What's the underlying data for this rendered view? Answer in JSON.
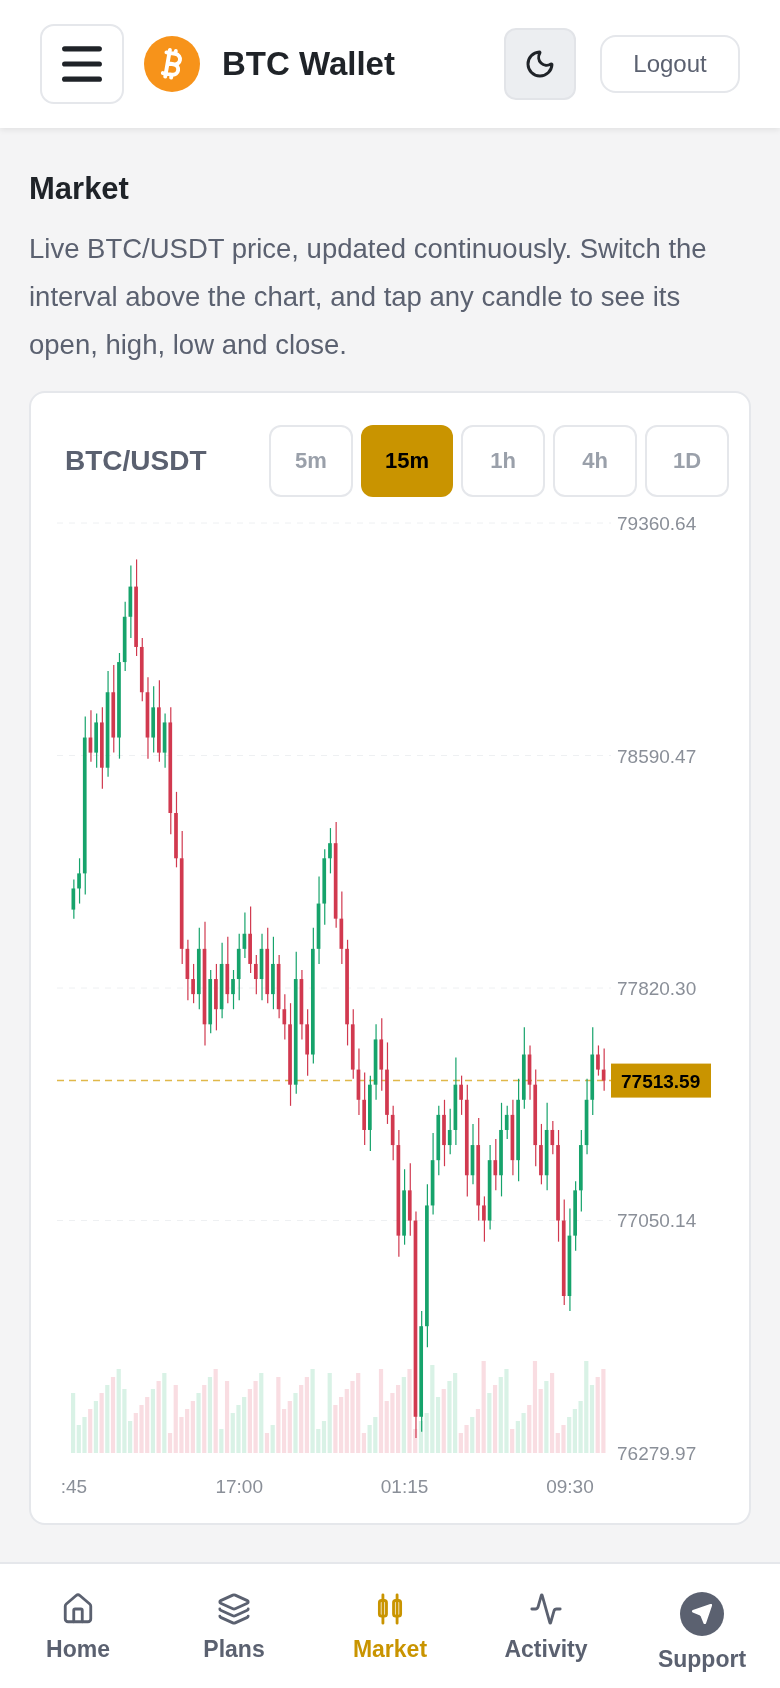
{
  "header": {
    "title": "BTC Wallet",
    "logout": "Logout"
  },
  "page": {
    "title": "Market",
    "description": "Live BTC/USDT price, updated continuously. Switch the interval above the chart, and tap any candle to see its open, high, low and close."
  },
  "chart_card": {
    "pair": "BTC/USDT",
    "intervals": [
      {
        "label": "5m",
        "selected": false
      },
      {
        "label": "15m",
        "selected": true
      },
      {
        "label": "1h",
        "selected": false
      },
      {
        "label": "4h",
        "selected": false
      },
      {
        "label": "1D",
        "selected": false
      }
    ],
    "chart_data": {
      "type": "candlestick",
      "grid": true,
      "ref_lines": [
        {
          "axis": "y",
          "value": 77513.59,
          "label": "77513.59"
        }
      ],
      "ylim": [
        76279.97,
        79360.64
      ],
      "yticks": [
        {
          "value": 79360.64,
          "label": "79360.64"
        },
        {
          "value": 78590.47,
          "label": "78590.47"
        },
        {
          "value": 77820.3,
          "label": "77820.30"
        },
        {
          "value": 77050.14,
          "label": "77050.14"
        },
        {
          "value": 76279.97,
          "label": "76279.97"
        }
      ],
      "categories": [
        ":45",
        null,
        null,
        null,
        null,
        null,
        null,
        null,
        null,
        null,
        null,
        null,
        null,
        null,
        null,
        null,
        null,
        null,
        null,
        null,
        null,
        null,
        null,
        null,
        null,
        null,
        null,
        null,
        null,
        "17:00",
        null,
        null,
        null,
        null,
        null,
        null,
        null,
        null,
        null,
        null,
        null,
        null,
        null,
        null,
        null,
        null,
        null,
        null,
        null,
        null,
        null,
        null,
        null,
        null,
        null,
        null,
        null,
        null,
        "01:15",
        null,
        null,
        null,
        null,
        null,
        null,
        null,
        null,
        null,
        null,
        null,
        null,
        null,
        null,
        null,
        null,
        null,
        null,
        null,
        null,
        null,
        null,
        null,
        null,
        null,
        null,
        null,
        null,
        "09:30",
        null,
        null,
        null,
        null,
        null,
        null
      ],
      "ohlc": [
        [
          78080,
          78180,
          78050,
          78150
        ],
        [
          78150,
          78250,
          78100,
          78200
        ],
        [
          78200,
          78720,
          78130,
          78650
        ],
        [
          78650,
          78740,
          78570,
          78600
        ],
        [
          78600,
          78730,
          78550,
          78700
        ],
        [
          78700,
          78750,
          78480,
          78550
        ],
        [
          78550,
          78870,
          78520,
          78800
        ],
        [
          78800,
          78890,
          78600,
          78650
        ],
        [
          78650,
          78930,
          78580,
          78900
        ],
        [
          78900,
          79100,
          78870,
          79050
        ],
        [
          79050,
          79220,
          78980,
          79150
        ],
        [
          79150,
          79240,
          78920,
          78950
        ],
        [
          78950,
          78980,
          78770,
          78800
        ],
        [
          78800,
          78850,
          78580,
          78650
        ],
        [
          78650,
          78820,
          78600,
          78750
        ],
        [
          78750,
          78840,
          78570,
          78600
        ],
        [
          78600,
          78730,
          78550,
          78700
        ],
        [
          78700,
          78750,
          78330,
          78400
        ],
        [
          78400,
          78470,
          78220,
          78250
        ],
        [
          78250,
          78340,
          77900,
          77950
        ],
        [
          77950,
          77980,
          77780,
          77850
        ],
        [
          77850,
          77900,
          77770,
          77800
        ],
        [
          77800,
          78020,
          77750,
          77950
        ],
        [
          77950,
          78040,
          77630,
          77700
        ],
        [
          77700,
          77880,
          77670,
          77850
        ],
        [
          77850,
          77900,
          77680,
          77750
        ],
        [
          77750,
          77970,
          77720,
          77900
        ],
        [
          77900,
          77990,
          77770,
          77800
        ],
        [
          77800,
          77880,
          77750,
          77850
        ],
        [
          77850,
          78000,
          77780,
          77950
        ],
        [
          77950,
          78070,
          77920,
          78000
        ],
        [
          78000,
          78090,
          77870,
          77900
        ],
        [
          77900,
          77930,
          77800,
          77850
        ],
        [
          77850,
          78000,
          77780,
          77950
        ],
        [
          77950,
          78020,
          77770,
          77800
        ],
        [
          77800,
          77990,
          77750,
          77900
        ],
        [
          77900,
          77930,
          77720,
          77750
        ],
        [
          77750,
          77800,
          77650,
          77700
        ],
        [
          77700,
          77770,
          77430,
          77500
        ],
        [
          77500,
          77940,
          77470,
          77850
        ],
        [
          77850,
          77880,
          77650,
          77700
        ],
        [
          77700,
          77750,
          77530,
          77600
        ],
        [
          77600,
          78020,
          77570,
          77950
        ],
        [
          77950,
          78190,
          77900,
          78100
        ],
        [
          78100,
          78280,
          78030,
          78250
        ],
        [
          78250,
          78350,
          78200,
          78300
        ],
        [
          78300,
          78370,
          78020,
          78050
        ],
        [
          78050,
          78140,
          77900,
          77950
        ],
        [
          77950,
          77980,
          77630,
          77700
        ],
        [
          77700,
          77750,
          77520,
          77550
        ],
        [
          77550,
          77620,
          77400,
          77450
        ],
        [
          77450,
          77540,
          77300,
          77350
        ],
        [
          77350,
          77530,
          77280,
          77500
        ],
        [
          77500,
          77700,
          77450,
          77650
        ],
        [
          77650,
          77720,
          77480,
          77550
        ],
        [
          77550,
          77640,
          77370,
          77400
        ],
        [
          77400,
          77430,
          77250,
          77300
        ],
        [
          77300,
          77350,
          76930,
          77000
        ],
        [
          77000,
          77220,
          76970,
          77150
        ],
        [
          77150,
          77240,
          77000,
          77050
        ],
        [
          77050,
          77080,
          76330,
          76400
        ],
        [
          76400,
          76750,
          76350,
          76700
        ],
        [
          76700,
          77170,
          76630,
          77100
        ],
        [
          77100,
          77340,
          77070,
          77250
        ],
        [
          77250,
          77430,
          77200,
          77400
        ],
        [
          77400,
          77450,
          77230,
          77300
        ],
        [
          77300,
          77420,
          77270,
          77350
        ],
        [
          77350,
          77590,
          77300,
          77500
        ],
        [
          77500,
          77530,
          77400,
          77450
        ],
        [
          77450,
          77500,
          77130,
          77200
        ],
        [
          77200,
          77370,
          77170,
          77300
        ],
        [
          77300,
          77390,
          77050,
          77100
        ],
        [
          77100,
          77130,
          76980,
          77050
        ],
        [
          77050,
          77300,
          77020,
          77250
        ],
        [
          77250,
          77320,
          77150,
          77200
        ],
        [
          77200,
          77440,
          77130,
          77350
        ],
        [
          77350,
          77430,
          77320,
          77400
        ],
        [
          77400,
          77450,
          77200,
          77250
        ],
        [
          77250,
          77520,
          77180,
          77450
        ],
        [
          77450,
          77690,
          77420,
          77600
        ],
        [
          77600,
          77630,
          77450,
          77500
        ],
        [
          77500,
          77550,
          77230,
          77300
        ],
        [
          77300,
          77370,
          77170,
          77200
        ],
        [
          77200,
          77440,
          77150,
          77350
        ],
        [
          77350,
          77380,
          77270,
          77300
        ],
        [
          77300,
          77350,
          76980,
          77050
        ],
        [
          77050,
          77120,
          76770,
          76800
        ],
        [
          76800,
          77090,
          76750,
          77000
        ],
        [
          77000,
          77180,
          76950,
          77150
        ],
        [
          77150,
          77350,
          77080,
          77300
        ],
        [
          77300,
          77520,
          77270,
          77450
        ],
        [
          77450,
          77690,
          77400,
          77600
        ],
        [
          77600,
          77630,
          77530,
          77550
        ],
        [
          77550,
          77620,
          77480,
          77513.59
        ]
      ]
    }
  },
  "bottom_nav": [
    {
      "label": "Home",
      "selected": false
    },
    {
      "label": "Plans",
      "selected": false
    },
    {
      "label": "Market",
      "selected": true
    },
    {
      "label": "Activity",
      "selected": false
    },
    {
      "label": "Support",
      "selected": false
    }
  ]
}
